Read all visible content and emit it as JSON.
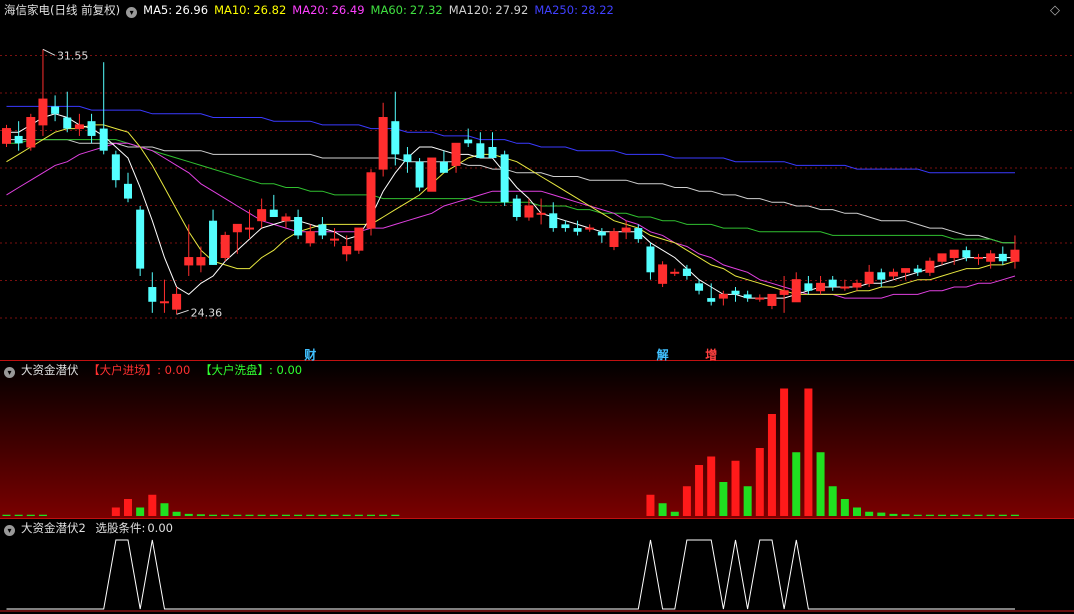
{
  "main": {
    "title": "海信家电(日线 前复权)",
    "ma": [
      {
        "label": "MA5:",
        "value": "26.96",
        "color": "#ffffff"
      },
      {
        "label": "MA10:",
        "value": "26.82",
        "color": "#ffff00"
      },
      {
        "label": "MA20:",
        "value": "26.49",
        "color": "#ff40ff"
      },
      {
        "label": "MA60:",
        "value": "27.32",
        "color": "#40e040"
      },
      {
        "label": "MA120:",
        "value": "27.92",
        "color": "#d0d0d0"
      },
      {
        "label": "MA250:",
        "value": "28.22",
        "color": "#4040ff"
      }
    ],
    "high_label": "31.55",
    "low_label": "24.36",
    "events": [
      {
        "text": "财",
        "bar": 25,
        "color": "#40c0ff"
      },
      {
        "text": "解",
        "bar": 54,
        "color": "#40c0ff"
      },
      {
        "text": "增",
        "bar": 58,
        "color": "#ff4040"
      }
    ]
  },
  "panel2": {
    "title": "大资金潜伏",
    "item1_label": "【大户进场】",
    "item1_value": ": 0.00",
    "item2_label": "【大户洗盘】",
    "item2_value": ": 0.00"
  },
  "panel3": {
    "title": "大资金潜伏2",
    "item_label": "选股条件:",
    "item_value": "0.00"
  },
  "chart_data": [
    {
      "type": "candlestick",
      "ylim": [
        23.5,
        32.4
      ],
      "grid": true,
      "ohlc": [
        [
          29.0,
          29.5,
          28.9,
          29.4
        ],
        [
          29.2,
          29.6,
          28.8,
          29.0
        ],
        [
          28.9,
          29.8,
          28.8,
          29.7
        ],
        [
          29.5,
          31.55,
          29.2,
          30.2
        ],
        [
          30.0,
          30.3,
          29.6,
          29.8
        ],
        [
          29.7,
          30.4,
          29.3,
          29.4
        ],
        [
          29.4,
          29.8,
          29.2,
          29.5
        ],
        [
          29.6,
          29.8,
          29.0,
          29.2
        ],
        [
          29.4,
          31.2,
          28.7,
          28.8
        ],
        [
          28.7,
          28.8,
          27.8,
          28.0
        ],
        [
          27.9,
          28.2,
          27.4,
          27.5
        ],
        [
          27.2,
          27.3,
          25.4,
          25.6
        ],
        [
          25.1,
          25.5,
          24.4,
          24.7
        ],
        [
          24.7,
          25.3,
          24.4,
          24.7
        ],
        [
          24.5,
          25.1,
          24.36,
          24.9
        ],
        [
          25.7,
          26.8,
          25.4,
          25.9
        ],
        [
          25.7,
          26.2,
          25.5,
          25.9
        ],
        [
          26.9,
          27.2,
          25.7,
          25.7
        ],
        [
          25.9,
          26.6,
          25.8,
          26.5
        ],
        [
          26.6,
          26.8,
          26.0,
          26.8
        ],
        [
          26.7,
          27.2,
          26.4,
          26.7
        ],
        [
          26.9,
          27.5,
          26.7,
          27.2
        ],
        [
          27.2,
          27.6,
          27.0,
          27.0
        ],
        [
          26.9,
          27.1,
          26.7,
          27.0
        ],
        [
          27.0,
          27.2,
          26.4,
          26.5
        ],
        [
          26.3,
          26.8,
          26.2,
          26.6
        ],
        [
          26.8,
          27.0,
          26.4,
          26.5
        ],
        [
          26.4,
          26.7,
          26.2,
          26.4
        ],
        [
          26.0,
          26.5,
          25.8,
          26.2
        ],
        [
          26.1,
          26.7,
          26.0,
          26.7
        ],
        [
          26.7,
          28.3,
          26.5,
          28.2
        ],
        [
          28.3,
          30.1,
          28.1,
          29.7
        ],
        [
          29.6,
          30.4,
          28.4,
          28.7
        ],
        [
          28.7,
          28.9,
          28.2,
          28.5
        ],
        [
          28.5,
          28.6,
          27.7,
          27.8
        ],
        [
          27.7,
          28.6,
          27.7,
          28.6
        ],
        [
          28.5,
          28.8,
          28.2,
          28.2
        ],
        [
          28.4,
          29.0,
          28.2,
          29.0
        ],
        [
          29.1,
          29.4,
          28.9,
          29.0
        ],
        [
          29.0,
          29.3,
          28.7,
          28.6
        ],
        [
          28.9,
          29.3,
          28.6,
          28.6
        ],
        [
          28.7,
          28.8,
          27.3,
          27.4
        ],
        [
          27.5,
          27.6,
          26.9,
          27.0
        ],
        [
          27.0,
          27.5,
          26.9,
          27.3
        ],
        [
          27.1,
          27.5,
          26.8,
          27.1
        ],
        [
          27.1,
          27.4,
          26.6,
          26.7
        ],
        [
          26.8,
          26.9,
          26.6,
          26.7
        ],
        [
          26.7,
          26.9,
          26.5,
          26.6
        ],
        [
          26.7,
          26.8,
          26.6,
          26.7
        ],
        [
          26.6,
          26.7,
          26.3,
          26.5
        ],
        [
          26.2,
          26.7,
          26.1,
          26.6
        ],
        [
          26.6,
          26.9,
          26.4,
          26.7
        ],
        [
          26.7,
          26.8,
          26.3,
          26.4
        ],
        [
          26.2,
          26.3,
          25.3,
          25.5
        ],
        [
          25.2,
          25.8,
          25.1,
          25.7
        ],
        [
          25.5,
          25.6,
          25.4,
          25.5
        ],
        [
          25.6,
          25.7,
          25.3,
          25.4
        ],
        [
          25.2,
          25.3,
          24.9,
          25.0
        ],
        [
          24.8,
          25.2,
          24.6,
          24.7
        ],
        [
          24.8,
          25.0,
          24.6,
          24.9
        ],
        [
          25.0,
          25.1,
          24.7,
          24.9
        ],
        [
          24.9,
          25.0,
          24.7,
          24.8
        ],
        [
          24.8,
          24.9,
          24.7,
          24.8
        ],
        [
          24.6,
          24.9,
          24.5,
          24.9
        ],
        [
          24.9,
          25.4,
          24.4,
          25.0
        ],
        [
          24.7,
          25.5,
          24.7,
          25.3
        ],
        [
          25.2,
          25.4,
          24.9,
          25.0
        ],
        [
          25.0,
          25.4,
          24.9,
          25.2
        ],
        [
          25.3,
          25.4,
          25.0,
          25.1
        ],
        [
          25.1,
          25.3,
          25.0,
          25.1
        ],
        [
          25.1,
          25.3,
          25.0,
          25.2
        ],
        [
          25.2,
          25.7,
          25.1,
          25.5
        ],
        [
          25.5,
          25.6,
          25.1,
          25.3
        ],
        [
          25.4,
          25.6,
          25.3,
          25.5
        ],
        [
          25.5,
          25.6,
          25.3,
          25.6
        ],
        [
          25.6,
          25.7,
          25.4,
          25.5
        ],
        [
          25.5,
          25.9,
          25.4,
          25.8
        ],
        [
          25.8,
          26.0,
          25.7,
          26.0
        ],
        [
          25.9,
          26.1,
          25.7,
          26.1
        ],
        [
          26.1,
          26.2,
          25.8,
          25.9
        ],
        [
          25.9,
          26.0,
          25.7,
          25.9
        ],
        [
          25.8,
          26.1,
          25.6,
          26.0
        ],
        [
          26.0,
          26.2,
          25.7,
          25.8
        ],
        [
          25.8,
          26.5,
          25.6,
          26.1
        ]
      ],
      "ma5": [
        29.3,
        29.3,
        29.5,
        29.7,
        29.8,
        29.7,
        29.5,
        29.4,
        29.2,
        28.9,
        28.6,
        27.8,
        26.9,
        25.9,
        25.1,
        24.9,
        25.2,
        25.4,
        25.8,
        26.1,
        26.4,
        26.7,
        26.8,
        26.9,
        26.9,
        26.8,
        26.7,
        26.6,
        26.4,
        26.5,
        27.0,
        27.7,
        28.2,
        28.6,
        28.9,
        28.9,
        28.8,
        28.7,
        28.7,
        28.6,
        28.6,
        28.2,
        27.8,
        27.5,
        27.1,
        27.0,
        26.9,
        26.8,
        26.7,
        26.6,
        26.6,
        26.6,
        26.6,
        26.3,
        26.1,
        25.9,
        25.6,
        25.3,
        25.1,
        24.9,
        24.9,
        24.8,
        24.8,
        24.8,
        24.8,
        24.9,
        25.0,
        25.1,
        25.1,
        25.1,
        25.1,
        25.2,
        25.2,
        25.3,
        25.4,
        25.5,
        25.6,
        25.7,
        25.8,
        25.9,
        25.9,
        25.9,
        25.9,
        25.9
      ],
      "ma10": [
        28.5,
        28.7,
        28.9,
        29.1,
        29.3,
        29.4,
        29.4,
        29.5,
        29.5,
        29.4,
        29.3,
        28.9,
        28.4,
        27.8,
        27.2,
        26.6,
        26.1,
        25.8,
        25.7,
        25.6,
        25.6,
        25.9,
        26.1,
        26.4,
        26.6,
        26.7,
        26.8,
        26.8,
        26.8,
        26.8,
        26.8,
        27.0,
        27.2,
        27.4,
        27.6,
        27.9,
        28.2,
        28.4,
        28.6,
        28.7,
        28.7,
        28.6,
        28.5,
        28.3,
        28.1,
        27.9,
        27.7,
        27.5,
        27.3,
        27.1,
        26.9,
        26.8,
        26.7,
        26.5,
        26.4,
        26.3,
        26.1,
        25.9,
        25.7,
        25.6,
        25.4,
        25.3,
        25.2,
        25.1,
        25.0,
        24.9,
        24.9,
        24.9,
        24.9,
        24.9,
        25.0,
        25.0,
        25.1,
        25.1,
        25.2,
        25.3,
        25.3,
        25.4,
        25.5,
        25.6,
        25.6,
        25.7,
        25.7,
        25.8
      ],
      "ma20": [
        27.6,
        27.8,
        28.0,
        28.2,
        28.4,
        28.5,
        28.7,
        28.8,
        28.9,
        29.0,
        29.0,
        28.9,
        28.8,
        28.6,
        28.4,
        28.2,
        27.9,
        27.7,
        27.5,
        27.3,
        27.1,
        26.9,
        26.8,
        26.7,
        26.6,
        26.6,
        26.6,
        26.6,
        26.6,
        26.6,
        26.7,
        26.7,
        26.8,
        26.9,
        27.0,
        27.1,
        27.3,
        27.4,
        27.5,
        27.6,
        27.7,
        27.7,
        27.7,
        27.7,
        27.7,
        27.6,
        27.5,
        27.4,
        27.3,
        27.2,
        27.1,
        26.9,
        26.8,
        26.6,
        26.5,
        26.3,
        26.2,
        26.0,
        25.9,
        25.7,
        25.6,
        25.5,
        25.3,
        25.2,
        25.1,
        25.0,
        24.9,
        24.9,
        24.9,
        24.8,
        24.8,
        24.8,
        24.8,
        24.9,
        24.9,
        24.9,
        25.0,
        25.0,
        25.1,
        25.1,
        25.2,
        25.2,
        25.3,
        25.4
      ],
      "ma60": [
        29.0,
        29.0,
        29.1,
        29.1,
        29.1,
        29.1,
        29.1,
        29.1,
        29.1,
        29.1,
        29.0,
        28.9,
        28.8,
        28.7,
        28.6,
        28.5,
        28.4,
        28.3,
        28.2,
        28.1,
        28.0,
        27.9,
        27.9,
        27.8,
        27.8,
        27.7,
        27.7,
        27.6,
        27.6,
        27.6,
        27.6,
        27.5,
        27.5,
        27.5,
        27.5,
        27.5,
        27.5,
        27.5,
        27.5,
        27.4,
        27.4,
        27.4,
        27.4,
        27.4,
        27.3,
        27.3,
        27.3,
        27.2,
        27.2,
        27.1,
        27.1,
        27.1,
        27.0,
        27.0,
        26.9,
        26.9,
        26.8,
        26.8,
        26.8,
        26.7,
        26.7,
        26.7,
        26.6,
        26.6,
        26.6,
        26.6,
        26.6,
        26.6,
        26.5,
        26.5,
        26.5,
        26.5,
        26.5,
        26.5,
        26.5,
        26.5,
        26.5,
        26.5,
        26.4,
        26.4,
        26.4,
        26.4,
        26.3,
        26.3
      ],
      "ma120": [
        29.1,
        29.1,
        29.1,
        29.1,
        29.1,
        29.1,
        29.0,
        29.0,
        29.0,
        29.0,
        28.9,
        28.9,
        28.9,
        28.8,
        28.8,
        28.8,
        28.8,
        28.7,
        28.7,
        28.7,
        28.7,
        28.7,
        28.7,
        28.7,
        28.7,
        28.7,
        28.6,
        28.6,
        28.6,
        28.6,
        28.6,
        28.6,
        28.6,
        28.5,
        28.5,
        28.5,
        28.5,
        28.5,
        28.4,
        28.4,
        28.3,
        28.3,
        28.2,
        28.2,
        28.2,
        28.1,
        28.1,
        28.1,
        28.0,
        28.0,
        28.0,
        28.0,
        27.9,
        27.9,
        27.9,
        27.8,
        27.8,
        27.7,
        27.7,
        27.6,
        27.6,
        27.5,
        27.5,
        27.4,
        27.4,
        27.3,
        27.3,
        27.2,
        27.2,
        27.1,
        27.1,
        27.0,
        26.9,
        26.9,
        26.9,
        26.8,
        26.7,
        26.7,
        26.6,
        26.5,
        26.5,
        26.4,
        26.3,
        26.3
      ],
      "ma250": [
        30.0,
        30.0,
        30.0,
        30.0,
        30.0,
        30.0,
        30.0,
        29.9,
        29.9,
        29.9,
        29.9,
        29.9,
        29.8,
        29.8,
        29.8,
        29.8,
        29.8,
        29.7,
        29.7,
        29.7,
        29.7,
        29.7,
        29.6,
        29.6,
        29.6,
        29.6,
        29.5,
        29.5,
        29.5,
        29.5,
        29.4,
        29.4,
        29.4,
        29.3,
        29.3,
        29.3,
        29.2,
        29.2,
        29.2,
        29.1,
        29.1,
        29.1,
        29.0,
        29.0,
        28.9,
        28.9,
        28.9,
        28.8,
        28.8,
        28.8,
        28.8,
        28.7,
        28.7,
        28.7,
        28.7,
        28.6,
        28.6,
        28.6,
        28.6,
        28.6,
        28.5,
        28.5,
        28.5,
        28.5,
        28.5,
        28.4,
        28.4,
        28.4,
        28.4,
        28.4,
        28.3,
        28.3,
        28.3,
        28.3,
        28.3,
        28.3,
        28.2,
        28.2,
        28.2,
        28.2,
        28.2,
        28.2,
        28.2,
        28.2
      ]
    },
    {
      "type": "bar",
      "red_bars": [
        [
          9,
          2
        ],
        [
          10,
          4
        ],
        [
          12,
          5
        ],
        [
          53,
          5
        ],
        [
          56,
          7
        ],
        [
          57,
          12
        ],
        [
          58,
          14
        ],
        [
          60,
          13
        ],
        [
          62,
          16
        ],
        [
          63,
          24
        ],
        [
          64,
          30
        ],
        [
          66,
          30
        ]
      ],
      "green_bars": [
        [
          0,
          0.3
        ],
        [
          1,
          0.3
        ],
        [
          2,
          0.3
        ],
        [
          3,
          0.3
        ],
        [
          11,
          2
        ],
        [
          13,
          3
        ],
        [
          14,
          1
        ],
        [
          15,
          0.5
        ],
        [
          16,
          0.4
        ],
        [
          17,
          0.3
        ],
        [
          18,
          0.3
        ],
        [
          19,
          0.3
        ],
        [
          20,
          0.3
        ],
        [
          21,
          0.3
        ],
        [
          22,
          0.3
        ],
        [
          23,
          0.3
        ],
        [
          24,
          0.3
        ],
        [
          25,
          0.3
        ],
        [
          26,
          0.3
        ],
        [
          27,
          0.3
        ],
        [
          28,
          0.3
        ],
        [
          29,
          0.3
        ],
        [
          30,
          0.3
        ],
        [
          31,
          0.3
        ],
        [
          32,
          0.3
        ],
        [
          54,
          3
        ],
        [
          55,
          1
        ],
        [
          59,
          8
        ],
        [
          61,
          7
        ],
        [
          65,
          15
        ],
        [
          67,
          15
        ],
        [
          68,
          7
        ],
        [
          69,
          4
        ],
        [
          70,
          2
        ],
        [
          71,
          1
        ],
        [
          72,
          0.8
        ],
        [
          73,
          0.5
        ],
        [
          74,
          0.4
        ],
        [
          75,
          0.3
        ],
        [
          76,
          0.3
        ],
        [
          77,
          0.3
        ],
        [
          78,
          0.3
        ],
        [
          79,
          0.3
        ],
        [
          80,
          0.3
        ],
        [
          81,
          0.3
        ],
        [
          82,
          0.3
        ],
        [
          83,
          0.3
        ]
      ],
      "ylim": [
        0,
        32
      ]
    },
    {
      "type": "line",
      "signal": [
        0,
        0,
        0,
        0,
        0,
        0,
        0,
        0,
        0,
        1,
        1,
        0,
        1,
        0,
        0,
        0,
        0,
        0,
        0,
        0,
        0,
        0,
        0,
        0,
        0,
        0,
        0,
        0,
        0,
        0,
        0,
        0,
        0,
        0,
        0,
        0,
        0,
        0,
        0,
        0,
        0,
        0,
        0,
        0,
        0,
        0,
        0,
        0,
        0,
        0,
        0,
        0,
        0,
        1,
        0,
        0,
        1,
        1,
        1,
        0,
        1,
        0,
        1,
        1,
        0,
        1,
        0,
        0,
        0,
        0,
        0,
        0,
        0,
        0,
        0,
        0,
        0,
        0,
        0,
        0,
        0,
        0,
        0,
        0
      ],
      "ylim": [
        0,
        1
      ]
    }
  ]
}
